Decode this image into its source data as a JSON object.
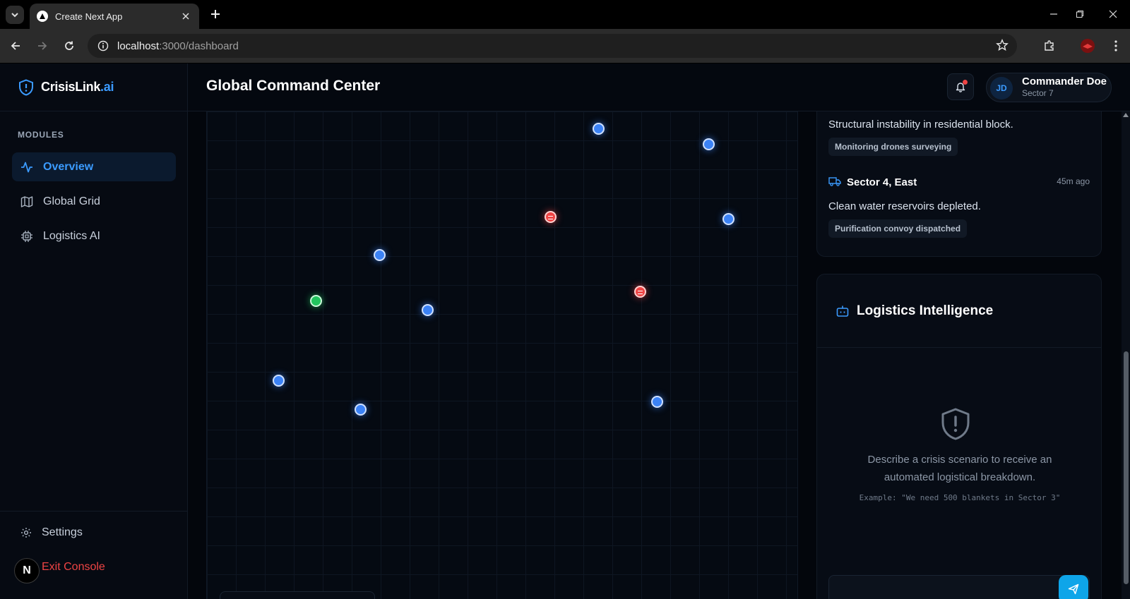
{
  "browser": {
    "tab_title": "Create Next App",
    "url_host": "localhost",
    "url_path": ":3000/dashboard"
  },
  "sidebar": {
    "brand_main": "CrisisLink",
    "brand_suffix": ".ai",
    "section_label": "MODULES",
    "items": [
      {
        "label": "Overview",
        "icon": "activity-icon",
        "active": true
      },
      {
        "label": "Global Grid",
        "icon": "map-icon",
        "active": false
      },
      {
        "label": "Logistics AI",
        "icon": "cpu-icon",
        "active": false
      }
    ],
    "settings_label": "Settings",
    "exit_label": "Exit Console",
    "bottom_avatar": "N"
  },
  "header": {
    "title": "Global Command Center",
    "user_initials": "JD",
    "user_name": "Commander Doe",
    "user_sector": "Sector 7"
  },
  "map": {
    "markers": [
      {
        "type": "blue"
      },
      {
        "type": "blue"
      },
      {
        "type": "red"
      },
      {
        "type": "blue"
      },
      {
        "type": "blue"
      },
      {
        "type": "green"
      },
      {
        "type": "blue"
      },
      {
        "type": "red"
      },
      {
        "type": "blue"
      },
      {
        "type": "blue"
      },
      {
        "type": "blue"
      }
    ]
  },
  "feed": {
    "item1_desc": "Structural instability in residential block.",
    "item1_action": "Monitoring drones surveying",
    "item2_title": "Sector 4, East",
    "item2_time": "45m ago",
    "item2_desc": "Clean water reservoirs depleted.",
    "item2_action": "Purification convoy dispatched"
  },
  "logistics": {
    "title": "Logistics Intelligence",
    "description": "Describe a crisis scenario to receive an automated logistical breakdown.",
    "example": "Example: \"We need 500 blankets in Sector 3\""
  },
  "colors": {
    "accent": "#3b9bff",
    "marker_blue": "#3b82f6",
    "marker_red": "#ef4444",
    "marker_green": "#22c55e",
    "exit": "#ef4444",
    "send": "#0ea5e9"
  }
}
